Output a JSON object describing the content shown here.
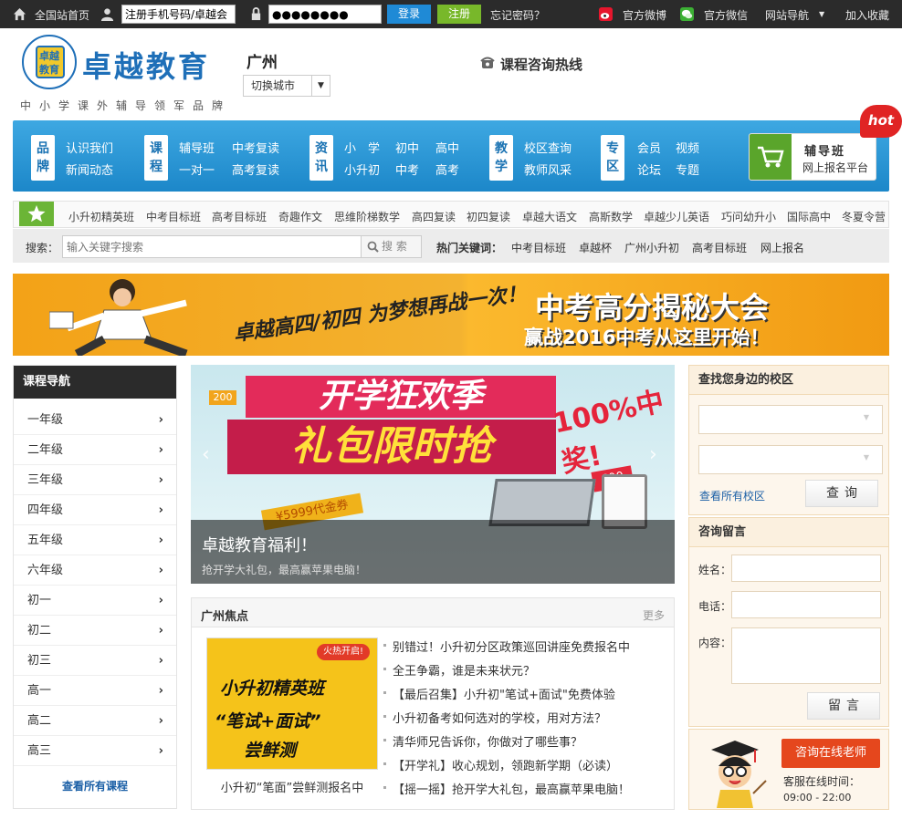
{
  "topbar": {
    "home": "全国站首页",
    "username_value": "注册手机号码/卓越会",
    "password_value": "●●●●●●●●",
    "login": "登录",
    "register": "注册",
    "forgot": "忘记密码？",
    "weibo": "官方微博",
    "wechat": "官方微信",
    "site_nav": "网站导航",
    "favorite": "加入收藏"
  },
  "header": {
    "logo_text": "卓越教育",
    "logo_badge_top": "卓越",
    "logo_badge_bottom": "教育",
    "slogan": "中小学课外辅导领军品牌",
    "city": "广州",
    "city_switch": "切换城市",
    "hotline": "课程咨询热线"
  },
  "mainnav": {
    "groups": [
      {
        "tag": "品牌",
        "links": [
          "认识我们",
          "新闻动态"
        ]
      },
      {
        "tag": "课程",
        "links": [
          "辅导班",
          "中考复读",
          "一对一",
          "高考复读"
        ]
      },
      {
        "tag": "资讯",
        "links": [
          "小　学",
          "初中",
          "高中",
          "小升初",
          "中考",
          "高考"
        ]
      },
      {
        "tag": "教学",
        "links": [
          "校区查询",
          "教师风采"
        ]
      },
      {
        "tag": "专区",
        "links": [
          "会员",
          "视频",
          "论坛",
          "专题"
        ]
      }
    ],
    "signup_title": "辅导班",
    "signup_sub": "网上报名平台",
    "hot": "hot"
  },
  "strip": {
    "courses": [
      "小升初精英班",
      "中考目标班",
      "高考目标班",
      "奇趣作文",
      "思维阶梯数学",
      "高四复读",
      "初四复读",
      "卓越大语文",
      "高斯数学",
      "卓越少儿英语",
      "巧问幼升小",
      "国际高中",
      "冬夏令营"
    ]
  },
  "search": {
    "label": "搜索：",
    "placeholder": "输入关键字搜索",
    "button": "搜 索",
    "hot_label": "热门关键词：",
    "hot_words": [
      "中考目标班",
      "卓越杯",
      "广州小升初",
      "高考目标班",
      "网上报名"
    ]
  },
  "banner": {
    "left": "卓越高四/初四 为梦想再战一次！",
    "right_1": "中考高分揭秘大会",
    "right_2": "赢战2016中考从这里开始！"
  },
  "leftnav": {
    "title": "课程导航",
    "items": [
      "一年级",
      "二年级",
      "三年级",
      "四年级",
      "五年级",
      "六年级",
      "初一",
      "初二",
      "初三",
      "高一",
      "高二",
      "高三"
    ],
    "chevron": "›",
    "all": "查看所有课程"
  },
  "slider": {
    "headline_1": "开学狂欢季",
    "headline_2": "礼包限时抢",
    "badge": "100%中奖!",
    "tag_200": "200",
    "tag_600": "600",
    "coupon": "¥5999代金券",
    "caption_title": "卓越教育福利！",
    "caption_sub": "抢开学大礼包，最高赢苹果电脑！",
    "prev": "‹",
    "next": "›"
  },
  "focus": {
    "title": "广州焦点",
    "more": "更多",
    "pic_tag": "火热开启!",
    "pic_line1": "小升初精英班",
    "pic_line2": "“笔试+面试”",
    "pic_line3": "尝鲜测",
    "pic_caption": "小升初“笔面”尝鲜测报名中",
    "news": [
      "别错过！小升初分区政策巡回讲座免费报名中",
      "全王争霸，谁是未来状元？",
      "【最后召集】小升初\"笔试+面试\"免费体验",
      "小升初备考如何选对的学校，用对方法？",
      "清华师兄告诉你，你做对了哪些事？",
      "【开学礼】收心规划，领跑新学期（必读）",
      "【摇一摇】抢开学大礼包，最高赢苹果电脑！"
    ]
  },
  "finder": {
    "title": "查找您身边的校区",
    "all_campus": "查看所有校区",
    "query": "查询"
  },
  "message": {
    "title": "咨询留言",
    "name_label": "姓名：",
    "phone_label": "电话：",
    "content_label": "内容：",
    "submit": "留言"
  },
  "service": {
    "button": "咨询在线老师",
    "hours_label": "客服在线时间：",
    "hours": "09:00 - 22:00"
  },
  "colors": {
    "accent_blue": "#1e87c9",
    "accent_green": "#6bb536",
    "dark_bar": "#2b2b2b",
    "orange": "#e5471d"
  }
}
